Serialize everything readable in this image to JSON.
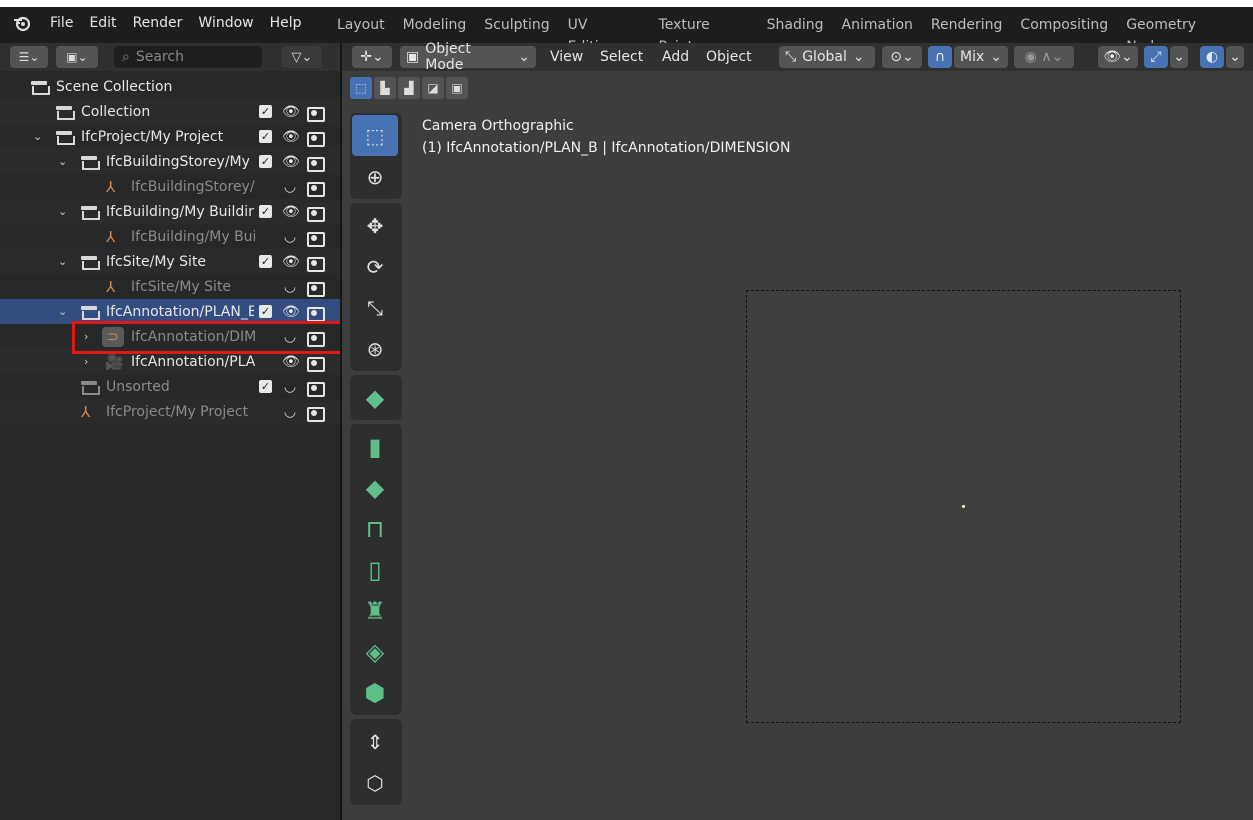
{
  "menu": {
    "items": [
      "File",
      "Edit",
      "Render",
      "Window",
      "Help"
    ]
  },
  "workspaces": [
    "Layout",
    "Modeling",
    "Sculpting",
    "UV Editing",
    "Texture Paint",
    "Shading",
    "Animation",
    "Rendering",
    "Compositing",
    "Geometry Nodes"
  ],
  "outliner": {
    "search_placeholder": "Search",
    "rows": [
      {
        "label": "Scene Collection"
      },
      {
        "label": "Collection"
      },
      {
        "label": "IfcProject/My Project"
      },
      {
        "label": "IfcBuildingStorey/My Storey"
      },
      {
        "label": "IfcBuildingStorey/My Storey"
      },
      {
        "label": "IfcBuilding/My Building"
      },
      {
        "label": "IfcBuilding/My Building"
      },
      {
        "label": "IfcSite/My Site"
      },
      {
        "label": "IfcSite/My Site"
      },
      {
        "label": "IfcAnnotation/PLAN_B"
      },
      {
        "label": "IfcAnnotation/DIMENSION"
      },
      {
        "label": "IfcAnnotation/PLAN_B"
      },
      {
        "label": "Unsorted"
      },
      {
        "label": "IfcProject/My Project"
      }
    ]
  },
  "viewport": {
    "mode": "Object Mode",
    "menus": [
      "View",
      "Select",
      "Add",
      "Object"
    ],
    "orientation": "Global",
    "snap": "Mix",
    "info_line1": "Camera Orthographic",
    "info_line2": "(1) IfcAnnotation/PLAN_B | IfcAnnotation/DIMENSION"
  },
  "colors": {
    "selection": "#334d80",
    "active_tool": "#4772b3",
    "highlight": "#e01818",
    "bim_green": "#5fbf8a"
  }
}
